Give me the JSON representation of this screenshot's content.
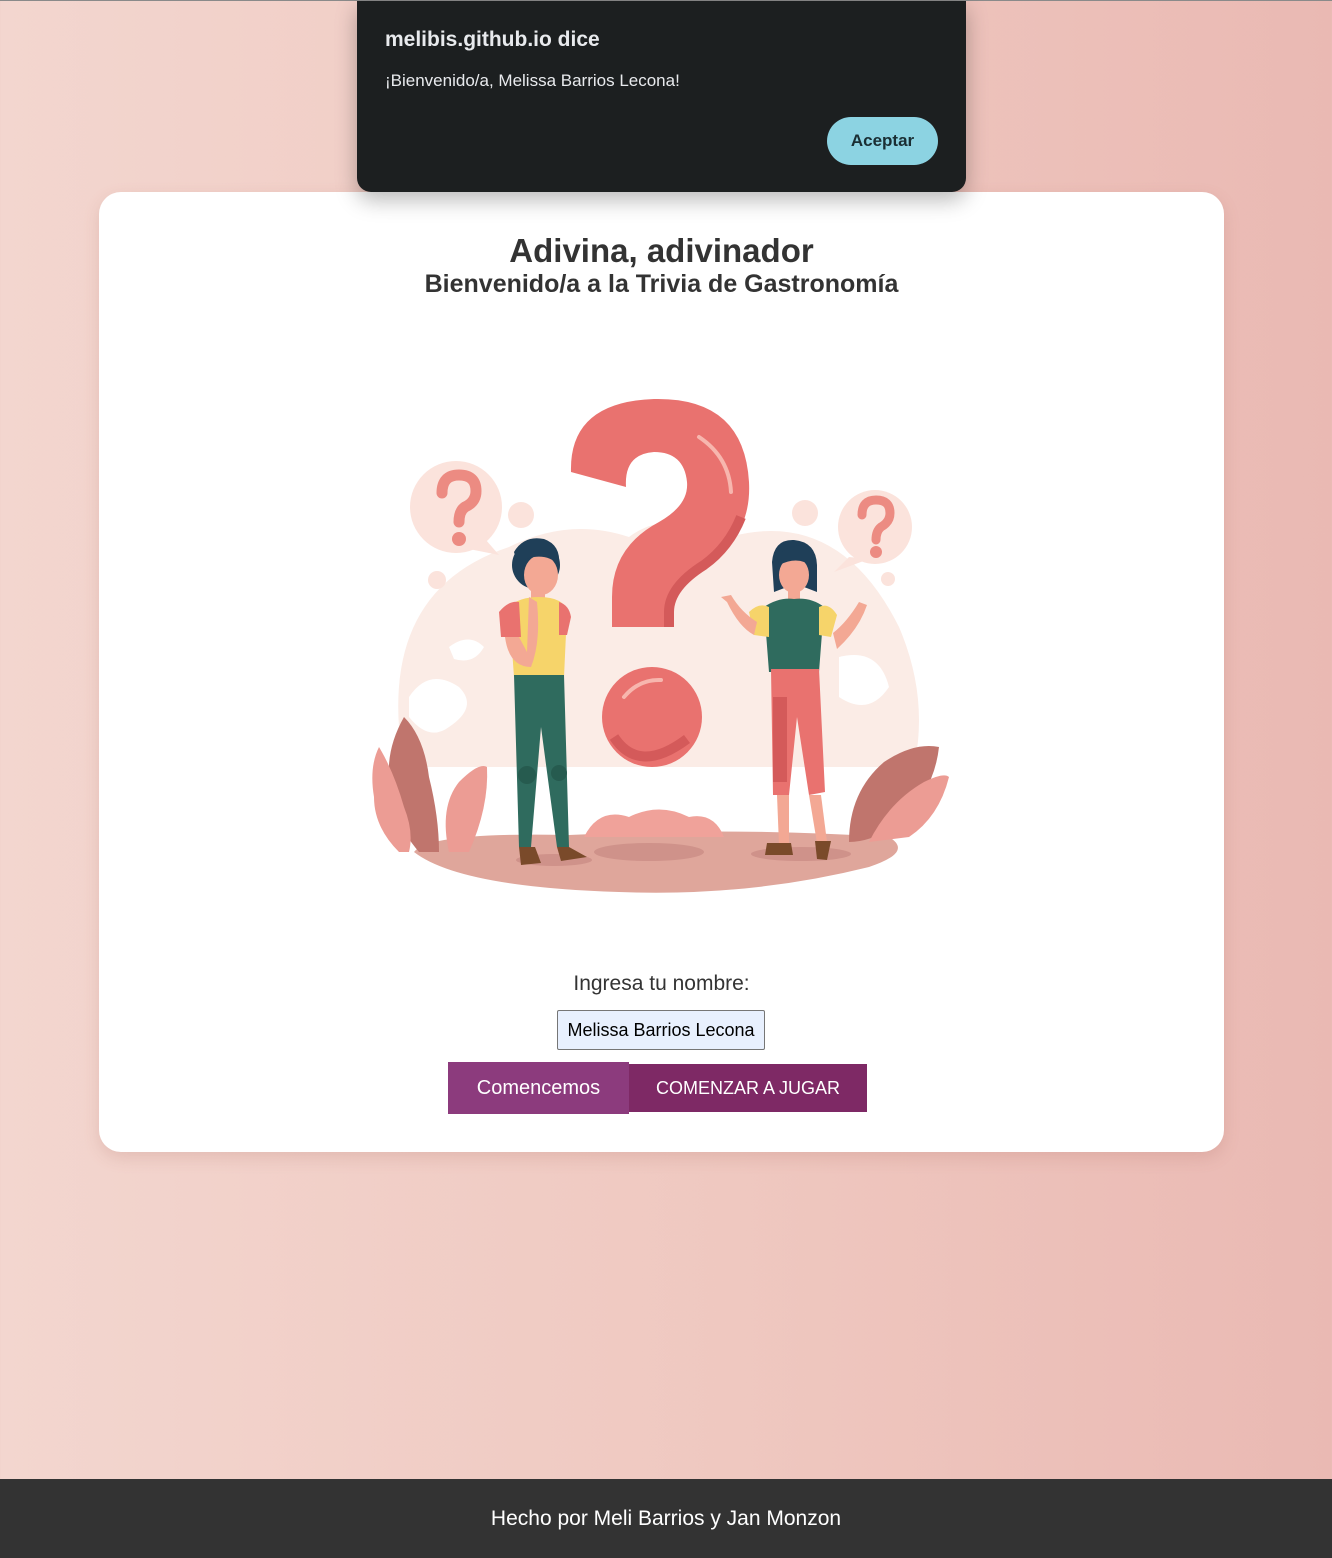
{
  "dialog": {
    "origin": "melibis.github.io dice",
    "message": "¡Bienvenido/a, Melissa Barrios Lecona!",
    "accept_label": "Aceptar"
  },
  "card": {
    "title": "Adivina, adivinador",
    "subtitle": "Bienvenido/a a la Trivia de Gastronomía",
    "illustration": "people-with-question-marks-illustration",
    "name_label": "Ingresa tu nombre:",
    "name_value": "Melissa Barrios Lecona",
    "start_label": "Comencemos",
    "play_label": "COMENZAR A JUGAR"
  },
  "footer": {
    "text": "Hecho por Meli Barrios y Jan Monzon"
  },
  "colors": {
    "background_left": "#f3d6cf",
    "background_right": "#eab9b3",
    "button_primary": "#8c3b7d",
    "button_secondary": "#7e2965",
    "dialog_bg": "#1c1f20",
    "dialog_accent": "#8cd3e2",
    "footer_bg": "#333333"
  }
}
